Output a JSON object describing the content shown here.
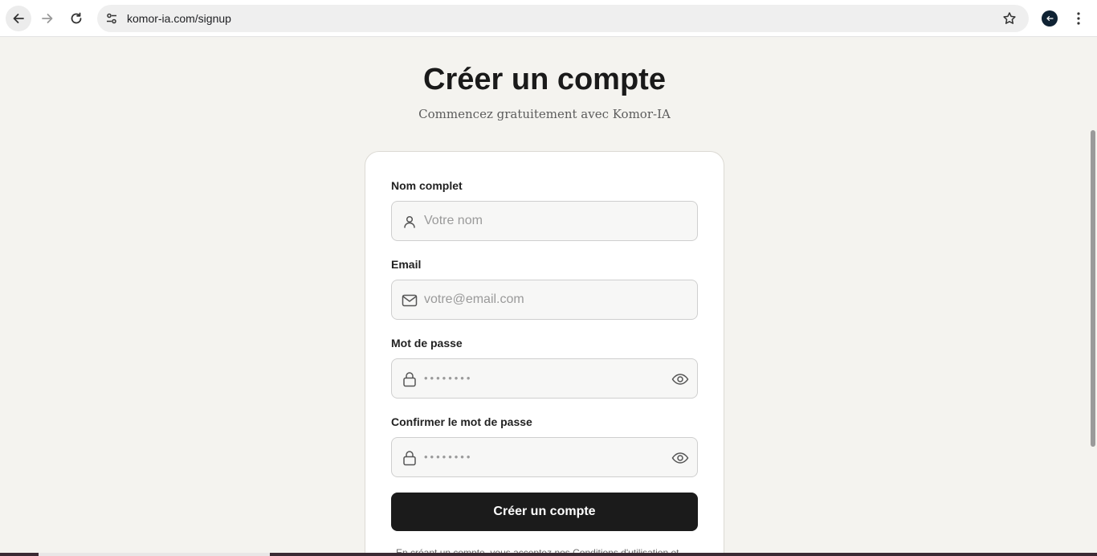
{
  "browser": {
    "url": "komor-ia.com/signup",
    "icons": {
      "back": "arrow-left-icon",
      "forward": "arrow-right-icon",
      "reload": "reload-icon",
      "site_info": "tune-icon",
      "bookmark": "star-icon",
      "profile": "profile-avatar-icon",
      "menu": "kebab-menu-icon"
    }
  },
  "page": {
    "title": "Créer un compte",
    "subtitle": "Commencez gratuitement avec Komor-IA"
  },
  "form": {
    "name": {
      "label": "Nom complet",
      "placeholder": "Votre nom",
      "value": "",
      "icon": "user-icon"
    },
    "email": {
      "label": "Email",
      "placeholder": "votre@email.com",
      "value": "",
      "icon": "mail-icon"
    },
    "password": {
      "label": "Mot de passe",
      "placeholder": "••••••••",
      "value": "",
      "icon": "lock-icon",
      "toggle_icon": "eye-icon"
    },
    "confirm": {
      "label": "Confirmer le mot de passe",
      "placeholder": "••••••••",
      "value": "",
      "icon": "lock-icon",
      "toggle_icon": "eye-icon"
    },
    "submit_label": "Créer un compte",
    "terms_text": "En créant un compte, vous acceptez nos Conditions d'utilisation et"
  },
  "colors": {
    "background": "#f4f3ef",
    "button": "#1b1b1b",
    "card": "#ffffff"
  }
}
